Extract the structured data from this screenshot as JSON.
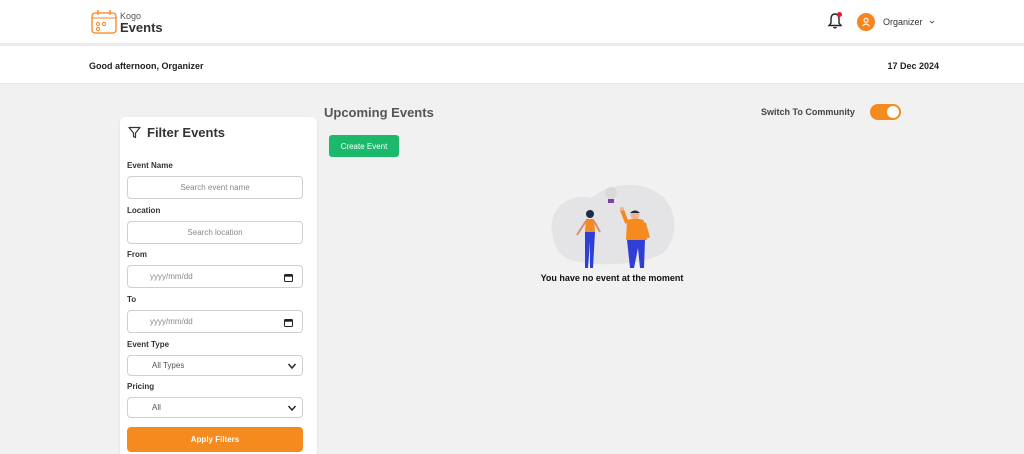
{
  "brand": {
    "small": "Kogo",
    "big": "Events",
    "accent": "#f5851f"
  },
  "header": {
    "user_name": "Organizer"
  },
  "greeting": {
    "text": "Good afternoon, Organizer",
    "date": "17 Dec 2024"
  },
  "filter": {
    "title": "Filter Events",
    "event_name_label": "Event Name",
    "event_name_placeholder": "Search event name",
    "location_label": "Location",
    "location_placeholder": "Search location",
    "from_label": "From",
    "from_placeholder": "yyyy/mm/dd",
    "to_label": "To",
    "to_placeholder": "yyyy/mm/dd",
    "event_type_label": "Event Type",
    "event_type_value": "All Types",
    "pricing_label": "Pricing",
    "pricing_value": "All",
    "apply_label": "Apply Filters"
  },
  "main": {
    "title": "Upcoming Events",
    "switch_label": "Switch To Community",
    "switch_on": true,
    "create_label": "Create Event",
    "empty_message": "You have no event at the moment"
  },
  "colors": {
    "primary_orange": "#f58a1f",
    "create_green": "#1cb86c",
    "notification_red": "#e11d2b"
  }
}
